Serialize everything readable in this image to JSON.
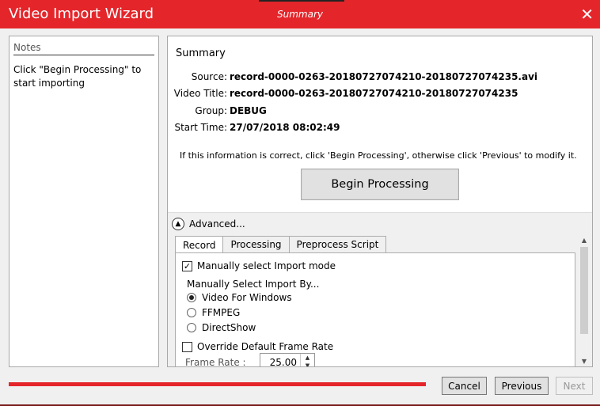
{
  "window": {
    "title": "Video Import Wizard",
    "step": "Summary",
    "close_glyph": "✕"
  },
  "notes": {
    "heading": "Notes",
    "text": "Click \"Begin Processing\" to start importing"
  },
  "summary": {
    "heading": "Summary",
    "fields": [
      {
        "label": "Source:",
        "value": "record-0000-0263-20180727074210-20180727074235.avi"
      },
      {
        "label": "Video Title:",
        "value": "record-0000-0263-20180727074210-20180727074235"
      },
      {
        "label": "Group:",
        "value": "DEBUG"
      },
      {
        "label": "Start Time:",
        "value": "27/07/2018 08:02:49"
      }
    ],
    "info": "If this information is correct, click 'Begin Processing', otherwise click 'Previous' to modify it.",
    "begin_label": "Begin Processing"
  },
  "advanced": {
    "label": "Advanced...",
    "tabs": [
      "Record",
      "Processing",
      "Preprocess Script"
    ],
    "active_tab": "Record",
    "manual_mode": {
      "label": "Manually select Import mode",
      "checked": true
    },
    "select_by_label": "Manually Select Import By...",
    "options": [
      {
        "label": "Video For Windows",
        "selected": true
      },
      {
        "label": "FFMPEG",
        "selected": false
      },
      {
        "label": "DirectShow",
        "selected": false
      }
    ],
    "override": {
      "label": "Override Default Frame Rate",
      "checked": false
    },
    "frame_rate": {
      "label": "Frame Rate   :",
      "value": "25.00"
    }
  },
  "footer": {
    "cancel": "Cancel",
    "previous": "Previous",
    "next": "Next",
    "progress_fraction": 1.0
  },
  "colors": {
    "accent": "#e4262b"
  }
}
